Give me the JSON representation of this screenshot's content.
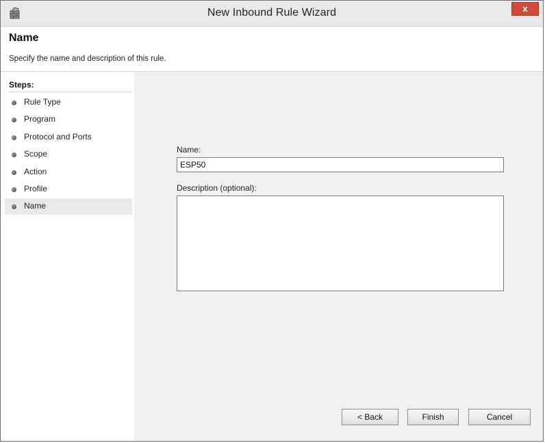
{
  "window": {
    "title": "New Inbound Rule Wizard",
    "close_glyph": "x"
  },
  "header": {
    "title": "Name",
    "subtitle": "Specify the name and description of this rule."
  },
  "steps": {
    "title": "Steps:",
    "items": [
      {
        "label": "Rule Type",
        "active": false
      },
      {
        "label": "Program",
        "active": false
      },
      {
        "label": "Protocol and Ports",
        "active": false
      },
      {
        "label": "Scope",
        "active": false
      },
      {
        "label": "Action",
        "active": false
      },
      {
        "label": "Profile",
        "active": false
      },
      {
        "label": "Name",
        "active": true
      }
    ]
  },
  "form": {
    "name_label": "Name:",
    "name_value": "ESP50",
    "description_label": "Description (optional):",
    "description_value": ""
  },
  "buttons": {
    "back": "< Back",
    "finish": "Finish",
    "cancel": "Cancel"
  },
  "colors": {
    "close_button": "#d24a3a",
    "window_background": "#f0f0f0",
    "active_step": "#e9e9e9"
  },
  "icons": {
    "title": "firewall-icon",
    "close": "close-icon",
    "step_bullet": "bullet-icon"
  }
}
